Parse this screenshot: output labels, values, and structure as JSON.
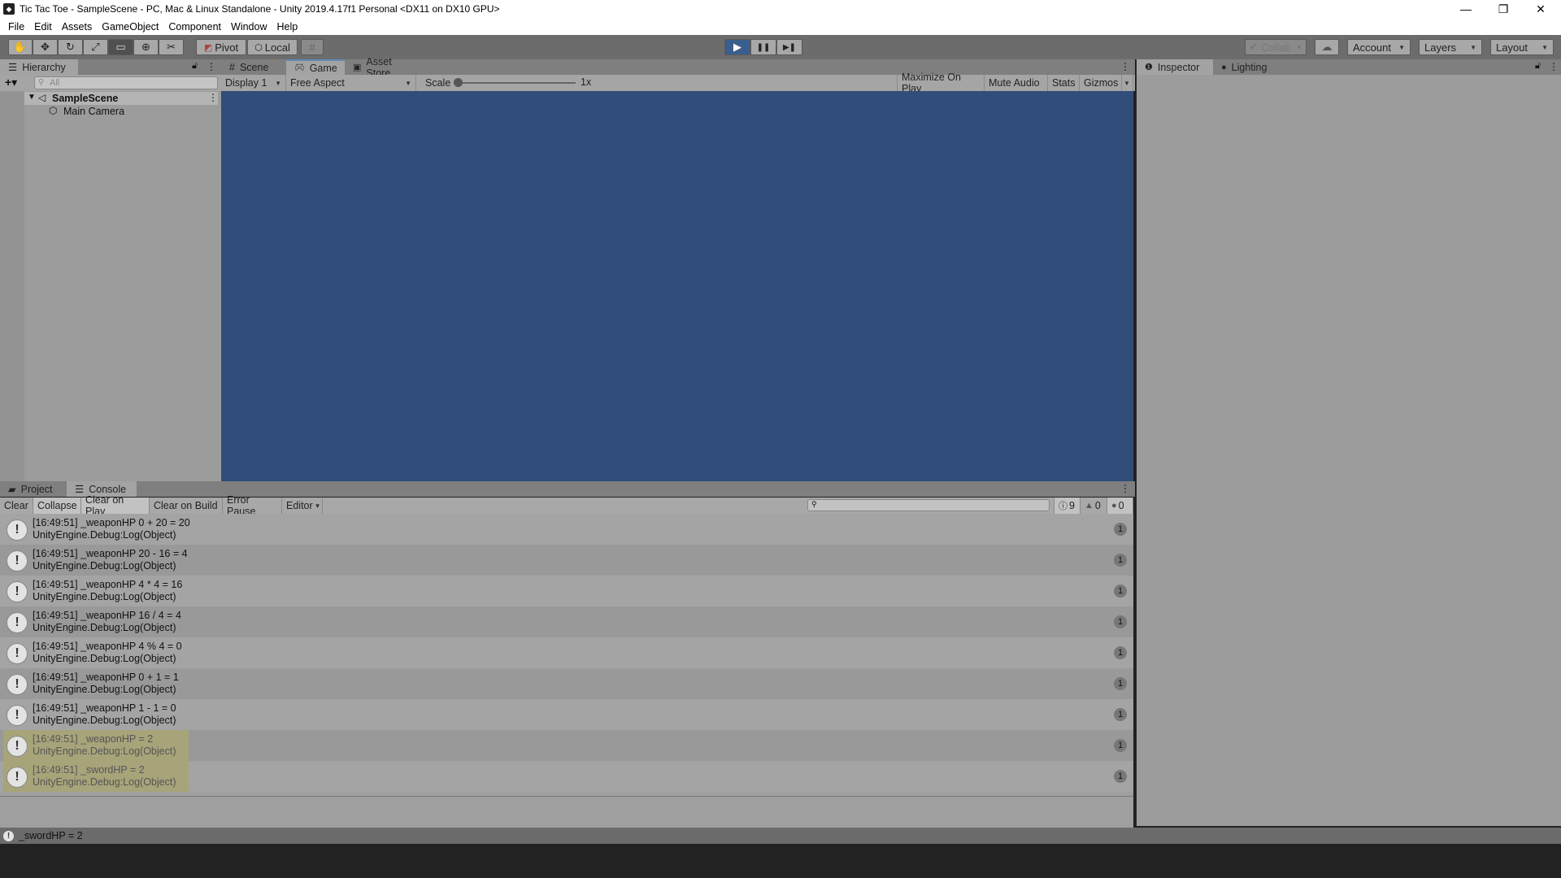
{
  "window": {
    "title": "Tic Tac Toe - SampleScene - PC, Mac & Linux Standalone - Unity 2019.4.17f1 Personal <DX11 on DX10 GPU>",
    "controls": {
      "minimize": "—",
      "restore": "❐",
      "close": "✕"
    }
  },
  "menu": [
    "File",
    "Edit",
    "Assets",
    "GameObject",
    "Component",
    "Window",
    "Help"
  ],
  "toolbar": {
    "tools": [
      {
        "name": "hand-tool",
        "glyph": "✋"
      },
      {
        "name": "move-tool",
        "glyph": "✥"
      },
      {
        "name": "rotate-tool",
        "glyph": "↻"
      },
      {
        "name": "scale-tool",
        "glyph": "⤢"
      },
      {
        "name": "rect-tool",
        "glyph": "▭"
      },
      {
        "name": "transform-tool",
        "glyph": "⊕"
      },
      {
        "name": "custom-tool",
        "glyph": "✂"
      }
    ],
    "pivot": "Pivot",
    "local": "Local",
    "grid": "#",
    "play": "▶",
    "pause": "❚❚",
    "step": "▶❚",
    "collab": "Collab",
    "cloud": "☁",
    "account": "Account",
    "layers": "Layers",
    "layout": "Layout"
  },
  "hierarchy": {
    "tab": "Hierarchy",
    "add": "+▾",
    "search_placeholder": "All",
    "scene": "SampleScene",
    "items": [
      "Main Camera"
    ]
  },
  "center_tabs": [
    "Scene",
    "Game",
    "Asset Store"
  ],
  "game_toolbar": {
    "display": "Display 1",
    "aspect": "Free Aspect",
    "scale_label": "Scale",
    "scale_value": "1x",
    "maximize": "Maximize On Play",
    "mute": "Mute Audio",
    "stats": "Stats",
    "gizmos": "Gizmos"
  },
  "inspector_tabs": [
    "Inspector",
    "Lighting"
  ],
  "bottom_tabs": [
    "Project",
    "Console"
  ],
  "console": {
    "buttons": [
      "Clear",
      "Collapse",
      "Clear on Play",
      "Clear on Build",
      "Error Pause",
      "Editor"
    ],
    "counts": {
      "info": "9",
      "warning": "0",
      "error": "0"
    },
    "logs": [
      {
        "line1": "[16:49:51] _weaponHP 0 + 20 = 20",
        "line2": "UnityEngine.Debug:Log(Object)",
        "count": "1"
      },
      {
        "line1": "[16:49:51] _weaponHP 20 - 16 = 4",
        "line2": "UnityEngine.Debug:Log(Object)",
        "count": "1"
      },
      {
        "line1": "[16:49:51] _weaponHP 4 * 4 = 16",
        "line2": "UnityEngine.Debug:Log(Object)",
        "count": "1"
      },
      {
        "line1": "[16:49:51] _weaponHP 16 / 4 = 4",
        "line2": "UnityEngine.Debug:Log(Object)",
        "count": "1"
      },
      {
        "line1": "[16:49:51] _weaponHP 4 % 4 = 0",
        "line2": "UnityEngine.Debug:Log(Object)",
        "count": "1"
      },
      {
        "line1": "[16:49:51] _weaponHP 0 + 1 = 1",
        "line2": "UnityEngine.Debug:Log(Object)",
        "count": "1"
      },
      {
        "line1": "[16:49:51] _weaponHP 1 - 1 = 0",
        "line2": "UnityEngine.Debug:Log(Object)",
        "count": "1"
      },
      {
        "line1": "[16:49:51] _weaponHP = 2",
        "line2": "UnityEngine.Debug:Log(Object)",
        "count": "1",
        "highlighted": true
      },
      {
        "line1": "[16:49:51] _swordHP = 2",
        "line2": "UnityEngine.Debug:Log(Object)",
        "count": "1",
        "highlighted": true
      }
    ]
  },
  "status": {
    "message": "_swordHP = 2"
  },
  "colors": {
    "game_bg": "#314d79",
    "play_active": "#3a5f8f",
    "highlight": "#a7a47a"
  }
}
